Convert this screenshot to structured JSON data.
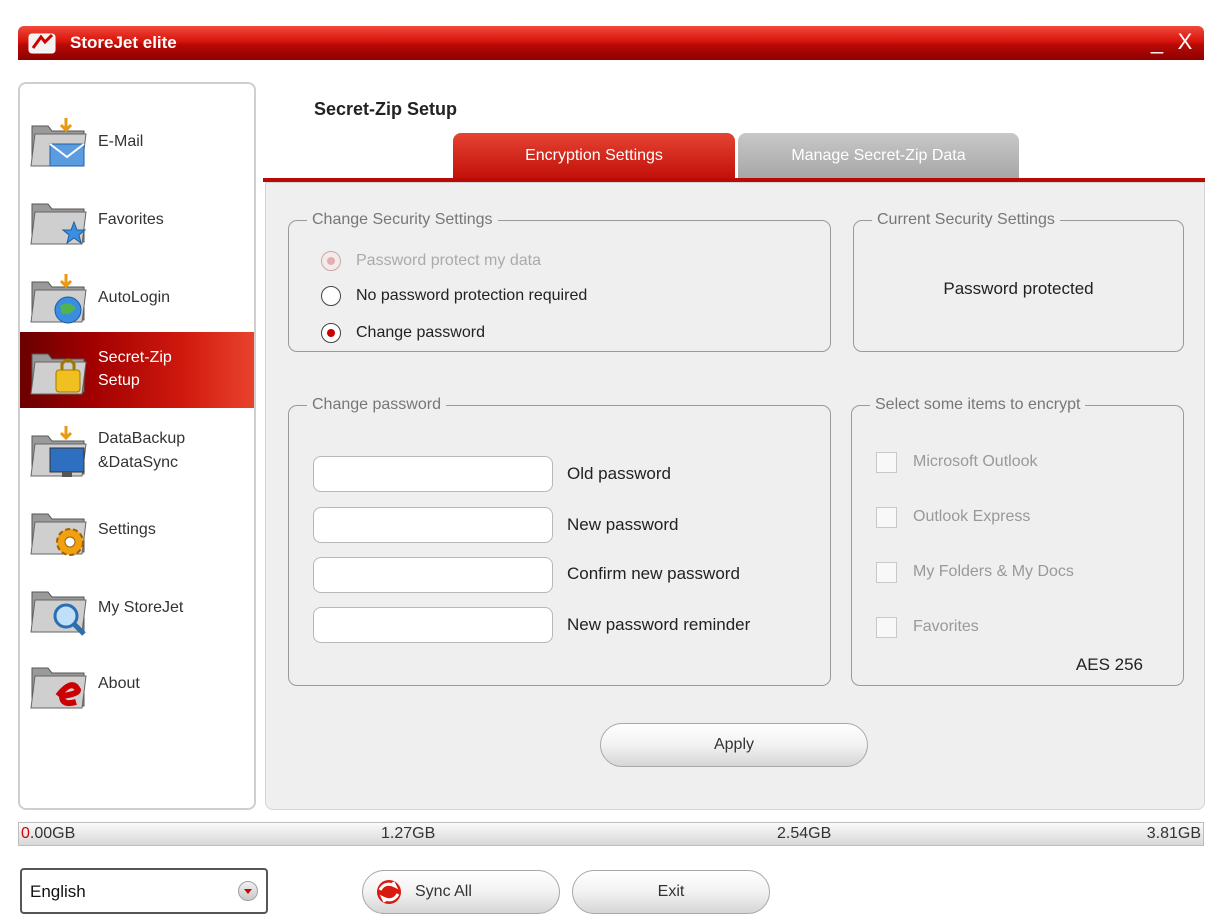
{
  "window": {
    "title": "StoreJet elite",
    "minimize_glyph": "_",
    "close_glyph": "X",
    "accent_color": "#c8120a"
  },
  "sidebar": {
    "items": [
      {
        "label": "E-Mail",
        "icon": "email-folder-icon"
      },
      {
        "label": "Favorites",
        "icon": "favorites-folder-icon"
      },
      {
        "label": "AutoLogin",
        "icon": "autologin-folder-icon"
      },
      {
        "label": "Secret-Zip Setup",
        "line1": "Secret-Zip",
        "line2": "Setup",
        "icon": "secret-zip-folder-icon",
        "active": true
      },
      {
        "label": "DataBackup &DataSync",
        "line1": "DataBackup",
        "line2": "&DataSync",
        "icon": "databackup-folder-icon"
      },
      {
        "label": "Settings",
        "icon": "settings-folder-icon"
      },
      {
        "label": "My StoreJet",
        "icon": "my-storejet-folder-icon"
      },
      {
        "label": "About",
        "icon": "about-folder-icon"
      }
    ]
  },
  "main": {
    "title": "Secret-Zip Setup",
    "tabs": [
      {
        "label": "Encryption Settings",
        "active": true
      },
      {
        "label": "Manage Secret-Zip Data",
        "active": false
      }
    ],
    "change_security": {
      "legend": "Change Security Settings",
      "options": [
        {
          "label": "Password protect my data",
          "selected": true,
          "disabled": true
        },
        {
          "label": "No password protection required",
          "selected": false,
          "disabled": false
        },
        {
          "label": "Change password",
          "selected": true,
          "disabled": false
        }
      ]
    },
    "current_security": {
      "legend": "Current Security Settings",
      "value": "Password protected"
    },
    "change_password": {
      "legend": "Change password",
      "fields": [
        {
          "label": "Old password",
          "value": ""
        },
        {
          "label": "New password",
          "value": ""
        },
        {
          "label": "Confirm new password",
          "value": ""
        },
        {
          "label": "New password reminder",
          "value": ""
        }
      ]
    },
    "encrypt_items": {
      "legend": "Select some items to encrypt",
      "items": [
        {
          "label": "Microsoft Outlook",
          "checked": false
        },
        {
          "label": "Outlook Express",
          "checked": false
        },
        {
          "label": "My Folders & My Docs",
          "checked": false
        },
        {
          "label": "Favorites",
          "checked": false
        }
      ],
      "algorithm": "AES 256"
    },
    "apply_label": "Apply"
  },
  "capacity": {
    "first_digit": "0",
    "first_rest": ".00GB",
    "labels": [
      "0.00GB",
      "1.27GB",
      "2.54GB",
      "3.81GB"
    ]
  },
  "footer": {
    "language": "English",
    "sync_label": "Sync All",
    "exit_label": "Exit"
  }
}
